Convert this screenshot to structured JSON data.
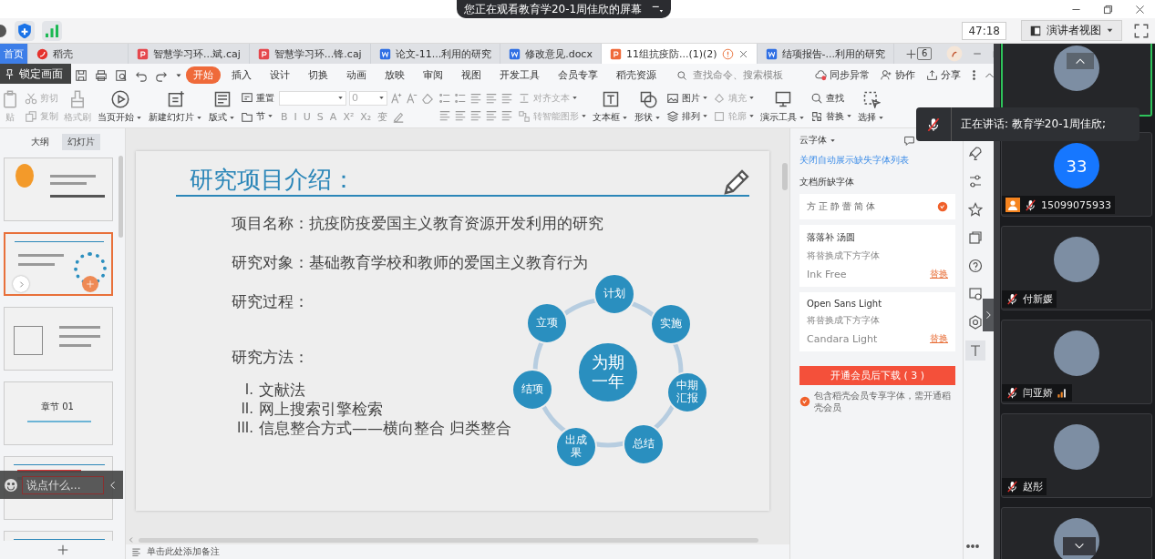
{
  "screen_banner": {
    "text": "您正在观看教育学20-1周佳欣的屏幕"
  },
  "meeting_bar": {
    "timer": "47:18",
    "view_button": "演讲者视图"
  },
  "wps": {
    "tabs": [
      {
        "label": "首页",
        "kind": "home",
        "selected": false
      },
      {
        "label": "稻壳",
        "kind": "docer",
        "selected": false
      },
      {
        "label": "智慧学习环...斌.caj",
        "kind": "pdf",
        "selected": false
      },
      {
        "label": "智慧学习环...锋.caj",
        "kind": "pdf",
        "selected": false
      },
      {
        "label": "论文-11...利用的研究",
        "kind": "word",
        "selected": false
      },
      {
        "label": "修改意见.docx",
        "kind": "word",
        "selected": false
      },
      {
        "label": "11组抗疫防...(1)(2)",
        "kind": "ppt",
        "selected": true
      },
      {
        "label": "结项报告-...利用的研究",
        "kind": "word",
        "selected": false
      }
    ],
    "window_badge": "6",
    "menu": [
      {
        "label": "开始",
        "selected": true
      },
      {
        "label": "插入",
        "selected": false
      },
      {
        "label": "设计",
        "selected": false
      },
      {
        "label": "切换",
        "selected": false
      },
      {
        "label": "动画",
        "selected": false
      },
      {
        "label": "放映",
        "selected": false
      },
      {
        "label": "审阅",
        "selected": false
      },
      {
        "label": "视图",
        "selected": false
      },
      {
        "label": "开发工具",
        "selected": false
      },
      {
        "label": "会员专享",
        "selected": false
      },
      {
        "label": "稻壳资源",
        "selected": false
      }
    ],
    "search": {
      "placeholder": "查找命令、搜索模板"
    },
    "menu_actions": [
      {
        "label": "同步异常",
        "kind": "cloud"
      },
      {
        "label": "协作",
        "kind": "people"
      },
      {
        "label": "分享",
        "kind": "share"
      }
    ],
    "ribbon": [
      {
        "kind": "large",
        "label": "贴",
        "caret": false,
        "disabled": true
      },
      {
        "kind": "stack",
        "items": [
          {
            "label": "剪切",
            "caret": false,
            "disabled": true
          },
          {
            "label": "复制",
            "caret": false,
            "disabled": true
          }
        ]
      },
      {
        "kind": "large",
        "label": "格式刷",
        "caret": false,
        "disabled": true
      },
      {
        "kind": "large",
        "label": "当页开始",
        "caret": true,
        "disabled": false
      },
      {
        "kind": "large",
        "label": "新建幻灯片",
        "caret": true,
        "disabled": false
      },
      {
        "kind": "large",
        "label": "版式",
        "caret": true,
        "disabled": false
      },
      {
        "kind": "stack",
        "items": [
          {
            "label": "重置",
            "caret": false,
            "disabled": false
          },
          {
            "label": "节",
            "caret": true,
            "disabled": false
          }
        ]
      },
      {
        "kind": "font",
        "size": "0",
        "format": [
          "B",
          "I",
          "U",
          "S",
          "A",
          "X²",
          "X₂",
          "变"
        ]
      },
      {
        "kind": "paragraph"
      },
      {
        "kind": "stack",
        "items": [
          {
            "label": "对齐文本",
            "caret": true,
            "disabled": true
          },
          {
            "label": "转智能图形",
            "caret": true,
            "disabled": true
          }
        ]
      },
      {
        "kind": "large",
        "label": "文本框",
        "caret": true,
        "disabled": false
      },
      {
        "kind": "large",
        "label": "形状",
        "caret": true,
        "disabled": false
      },
      {
        "kind": "stack",
        "items": [
          {
            "label": "图片",
            "caret": true,
            "disabled": false
          },
          {
            "label": "排列",
            "caret": true,
            "disabled": false
          }
        ]
      },
      {
        "kind": "stack",
        "items": [
          {
            "label": "填充",
            "caret": true,
            "disabled": true
          },
          {
            "label": "轮廓",
            "caret": true,
            "disabled": true
          }
        ]
      },
      {
        "kind": "large",
        "label": "演示工具",
        "caret": true,
        "disabled": false
      },
      {
        "kind": "stack",
        "items": [
          {
            "label": "查找",
            "caret": false,
            "disabled": false
          },
          {
            "label": "替换",
            "caret": true,
            "disabled": false
          }
        ]
      },
      {
        "kind": "large",
        "label": "选择",
        "caret": true,
        "disabled": false
      }
    ],
    "panel_tabs": [
      {
        "label": "大纲",
        "selected": false
      },
      {
        "label": "幻灯片",
        "selected": true
      }
    ],
    "thumbnails": [
      {
        "kind": "title",
        "selected": false
      },
      {
        "kind": "diagram",
        "selected": true
      },
      {
        "kind": "list",
        "selected": false
      },
      {
        "kind": "section",
        "selected": false,
        "text": "章节 01"
      },
      {
        "kind": "text",
        "selected": false
      },
      {
        "kind": "text",
        "selected": false
      }
    ],
    "slide": {
      "title": "研究项目介绍：",
      "lines": [
        "项目名称：抗疫防疫爱国主义教育资源开发利用的研究",
        "研究对象：基础教育学校和教师的爱国主义教育行为",
        "研究过程：",
        "研究方法："
      ],
      "methods": [
        {
          "marker": "I.",
          "text": "文献法"
        },
        {
          "marker": "II.",
          "text": "网上搜索引擎检索"
        },
        {
          "marker": "III.",
          "text": "信息整合方式——横向整合 归类整合"
        }
      ],
      "cycle": {
        "center": "为期一年",
        "nodes": [
          "计划",
          "实施",
          "中期汇报",
          "总结",
          "出成果",
          "结项",
          "立项"
        ]
      }
    },
    "notes": "单击此处添加备注",
    "font_panel": {
      "title": "云字体",
      "link": "关闭自动展示缺失字体列表",
      "section": "文档所缺字体",
      "fonts": [
        {
          "kind": "premium",
          "name": "方正静蕾简体"
        },
        {
          "kind": "replace",
          "name": "落落补 汤圆",
          "hint": "将替换成下方字体",
          "replacement": "Ink Free",
          "action": "替换"
        },
        {
          "kind": "replace",
          "name": "Open Sans Light",
          "hint": "将替换成下方字体",
          "replacement": "Candara Light",
          "action": "替换"
        }
      ],
      "download_button": "开通会员后下载 ( 3 )",
      "note": "包含稻壳会员专享字体，需开通稻壳会员"
    },
    "side_tools": [
      {
        "selected": false
      },
      {
        "selected": false
      },
      {
        "selected": false
      },
      {
        "selected": false
      },
      {
        "selected": false
      },
      {
        "selected": false
      },
      {
        "selected": false
      },
      {
        "selected": true
      }
    ]
  },
  "participants": [
    {
      "kind": "photo",
      "speaking": true
    },
    {
      "kind": "number",
      "avatar_text": "33",
      "name": "15099075933",
      "host": true,
      "muted": true,
      "speaking": false
    },
    {
      "kind": "photo",
      "name": "付新媛",
      "muted": true,
      "speaking": false
    },
    {
      "kind": "photo",
      "name": "闫亚娇",
      "muted": true,
      "signal": true,
      "speaking": false
    },
    {
      "kind": "photo",
      "name": "赵彤",
      "muted": true,
      "speaking": false
    },
    {
      "kind": "photo",
      "speaking": false
    }
  ],
  "overlays": {
    "lock_tip": "锁定画面",
    "chat": {
      "placeholder": "说点什么..."
    },
    "speaking": "正在讲话: 教育学20-1周佳欣;"
  }
}
